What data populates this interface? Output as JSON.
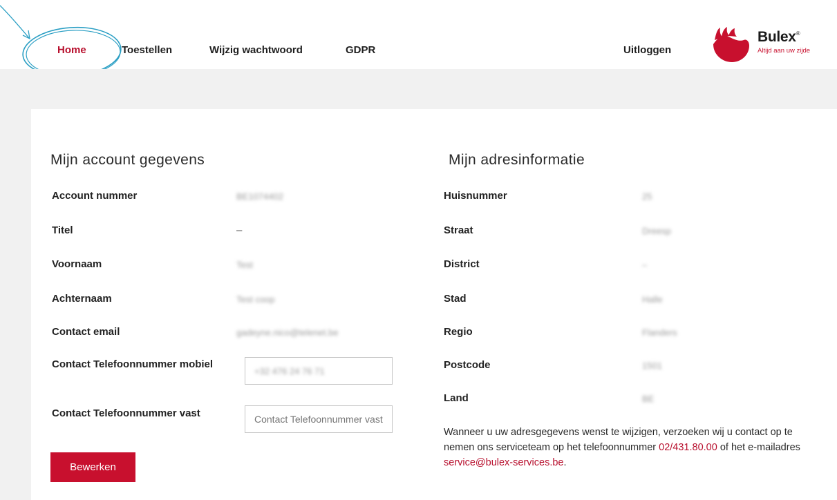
{
  "nav": {
    "items": [
      {
        "label": "Home",
        "active": true
      },
      {
        "label": "Toestellen",
        "active": false
      },
      {
        "label": "Wijzig wachtwoord",
        "active": false
      },
      {
        "label": "GDPR",
        "active": false
      }
    ],
    "logout_label": "Uitloggen"
  },
  "brand": {
    "name": "Bulex",
    "mark": "®",
    "tagline": "Altijd aan uw zijde",
    "color": "#c8102e"
  },
  "account": {
    "title": "Mijn account gegevens",
    "rows": [
      {
        "label": "Account nummer",
        "value": "BE1074402"
      },
      {
        "label": "Titel",
        "value": "–"
      },
      {
        "label": "Voornaam",
        "value": "Test"
      },
      {
        "label": "Achternaam",
        "value": "Test coop"
      },
      {
        "label": "Contact email",
        "value": "gadeyne.nico@telenet.be"
      }
    ],
    "mobile_label": "Contact Telefoonnummer mobiel",
    "mobile_value": "+32 476 24 76 71",
    "landline_label": "Contact Telefoonnummer vast",
    "landline_placeholder": "Contact Telefoonnummer vast",
    "edit_button": "Bewerken"
  },
  "address": {
    "title": "Mijn adresinformatie",
    "rows": [
      {
        "label": "Huisnummer",
        "value": "25"
      },
      {
        "label": "Straat",
        "value": "Dreesp"
      },
      {
        "label": "District",
        "value": "–"
      },
      {
        "label": "Stad",
        "value": "Halle"
      },
      {
        "label": "Regio",
        "value": "Flanders"
      },
      {
        "label": "Postcode",
        "value": "1501"
      },
      {
        "label": "Land",
        "value": "BE"
      }
    ],
    "notice_text_1": "Wanneer u uw adresgegevens wenst te wijzigen, verzoeken wij u contact op te nemen ons serviceteam op het telefoonnummer ",
    "notice_phone": "02/431.80.00",
    "notice_text_2": " of het e-mailadres ",
    "notice_email": "service@bulex-services.be",
    "notice_text_3": "."
  }
}
